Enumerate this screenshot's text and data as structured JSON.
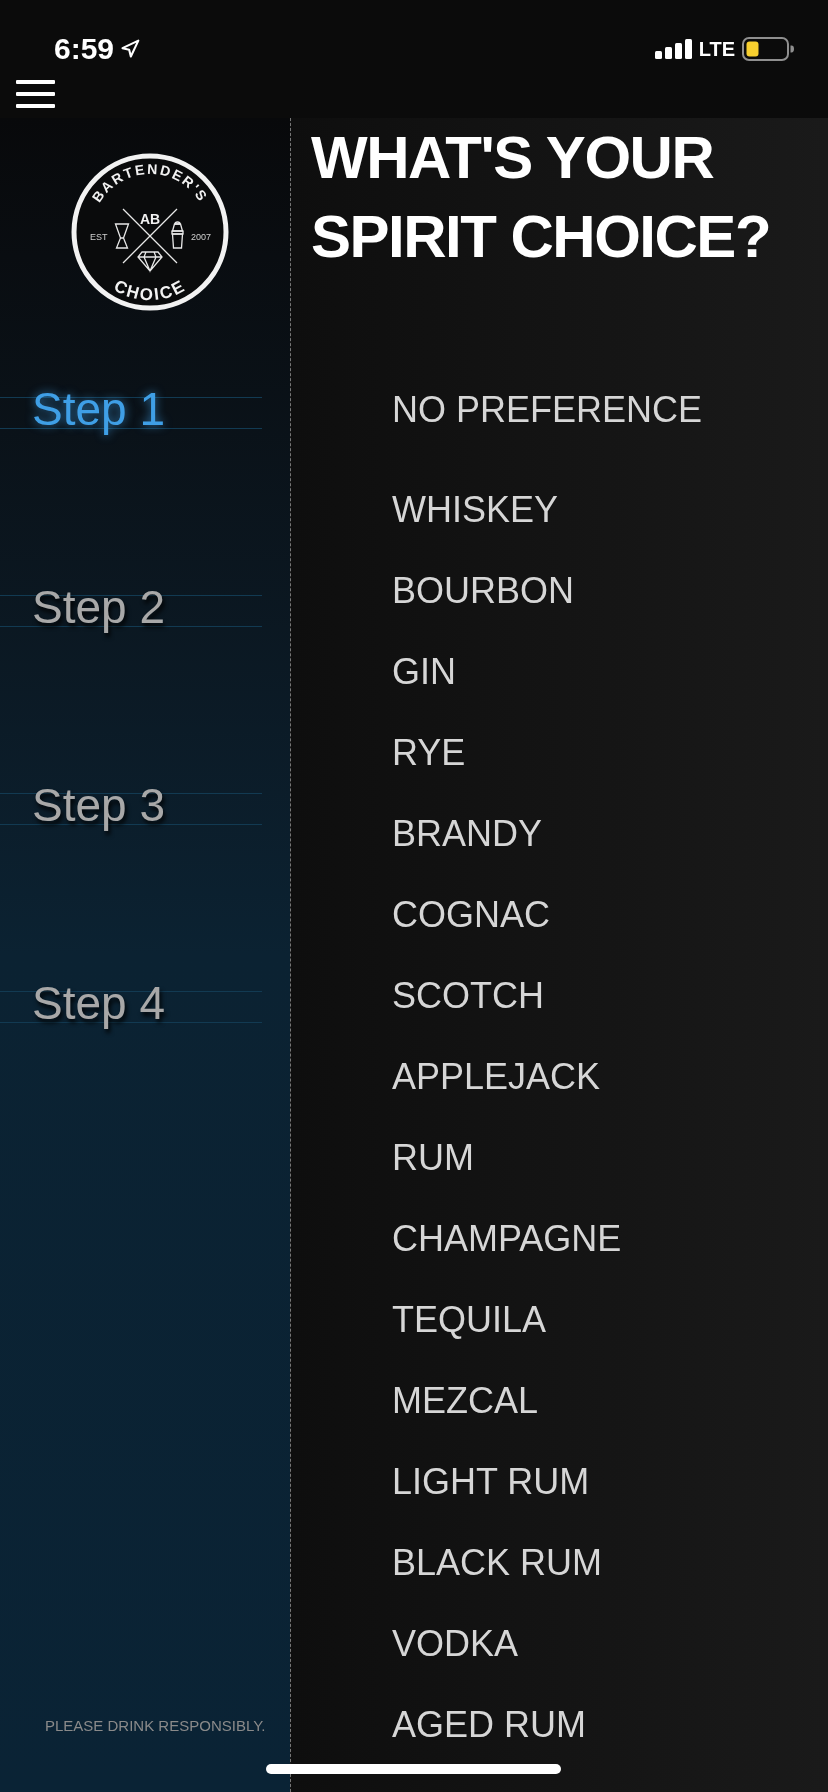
{
  "status_bar": {
    "time": "6:59",
    "network": "LTE"
  },
  "logo": {
    "top_text": "BARTENDER'S",
    "monogram": "AB",
    "left_text": "EST",
    "right_text": "2007",
    "bottom_text": "CHOICE"
  },
  "steps": [
    {
      "label": "Step 1",
      "selected": true
    },
    {
      "label": "Step 2",
      "selected": false
    },
    {
      "label": "Step 3",
      "selected": false
    },
    {
      "label": "Step 4",
      "selected": false
    }
  ],
  "footer_note": "PLEASE DRINK RESPONSIBLY.",
  "title": "WHAT'S YOUR SPIRIT CHOICE?",
  "spirits": [
    {
      "label": "NO PREFERENCE",
      "selected": false
    },
    {
      "label": "WHISKEY",
      "selected": false
    },
    {
      "label": "BOURBON",
      "selected": false
    },
    {
      "label": "GIN",
      "selected": false
    },
    {
      "label": "RYE",
      "selected": false
    },
    {
      "label": "BRANDY",
      "selected": false
    },
    {
      "label": "COGNAC",
      "selected": false
    },
    {
      "label": "SCOTCH",
      "selected": false
    },
    {
      "label": "APPLEJACK",
      "selected": false
    },
    {
      "label": "RUM",
      "selected": false
    },
    {
      "label": "CHAMPAGNE",
      "selected": false
    },
    {
      "label": "TEQUILA",
      "selected": false
    },
    {
      "label": "MEZCAL",
      "selected": false
    },
    {
      "label": "LIGHT RUM",
      "selected": false
    },
    {
      "label": "BLACK RUM",
      "selected": false
    },
    {
      "label": "VODKA",
      "selected": false
    },
    {
      "label": "AGED RUM",
      "selected": false
    }
  ]
}
